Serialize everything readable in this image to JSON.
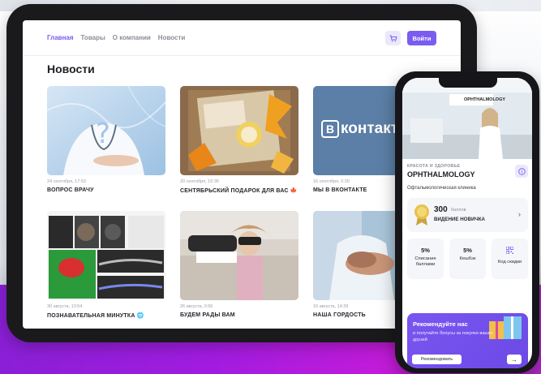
{
  "nav": {
    "links": [
      "Главная",
      "Товары",
      "О компании",
      "Новости"
    ],
    "login": "Войти"
  },
  "page_title": "Новости",
  "news": [
    {
      "date": "24 сентября, 17:53",
      "title": "ВОПРОС  ВРАЧУ"
    },
    {
      "date": "20 сентября, 16:35",
      "title": "СЕНТЯБРЬСКИЙ ПОДАРОК ДЛЯ ВАС 🍁"
    },
    {
      "date": "16 сентября, 0:30",
      "title": "МЫ В ВКОНТАКТЕ"
    },
    {
      "date": "30 августа, 13:54",
      "title": "ПОЗНАВАТЕЛЬНАЯ МИНУТКА 🌐"
    },
    {
      "date": "26 августа, 0:56",
      "title": "БУДЕМ РАДЫ ВАМ"
    },
    {
      "date": "16 августа, 14:39",
      "title": "НАША ГОРДОСТЬ"
    }
  ],
  "vk_logo_text": "контакт",
  "phone": {
    "banner_brand": "OPHTHALMOLOGY",
    "category": "КРАСОТА И ЗДОРОВЬЕ",
    "title": "OPHTHALMOLOGY",
    "description": "Офтальмологическая клиника",
    "points": "300",
    "points_unit": "баллов",
    "level": "ВИДЕНИЕ НОВИЧКА",
    "tiles": [
      {
        "big": "5%",
        "label": "Списание баллами"
      },
      {
        "big": "5%",
        "label": "Кешбэк"
      },
      {
        "big": "",
        "label": "Код скидки"
      }
    ],
    "promo": {
      "title": "Рекомендуйте нас",
      "subtitle": "и получайте бонусы за покупки ваших друзей",
      "button": "Рекомендовать"
    }
  },
  "colors": {
    "accent": "#7b5cf0",
    "tablet_frame": "#1a1a1d",
    "purple_band": "#a21ce0"
  }
}
